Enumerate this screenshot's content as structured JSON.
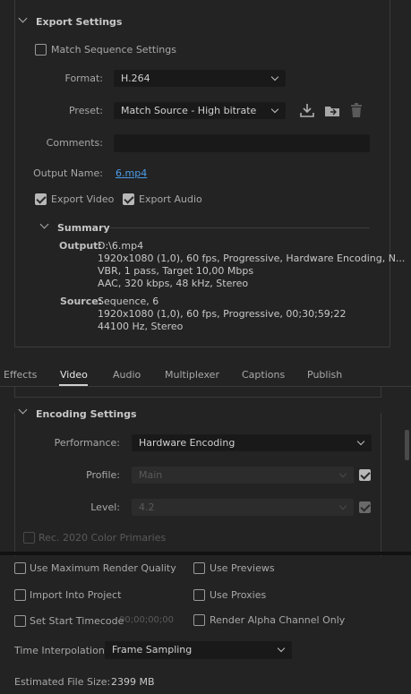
{
  "export_settings": {
    "title": "Export Settings",
    "match_sequence": "Match Sequence Settings",
    "format_label": "Format:",
    "format_value": "H.264",
    "preset_label": "Preset:",
    "preset_value": "Match Source - High bitrate",
    "comments_label": "Comments:",
    "comments_value": "",
    "output_name_label": "Output Name:",
    "output_name_value": "6.mp4",
    "export_video": "Export Video",
    "export_audio": "Export Audio"
  },
  "summary": {
    "title": "Summary",
    "output_label": "Output:",
    "output_lines": [
      "D:\\6.mp4",
      "1920x1080 (1,0), 60 fps, Progressive, Hardware Encoding, N...",
      "VBR, 1 pass, Target 10,00 Mbps",
      "AAC, 320 kbps, 48 kHz, Stereo"
    ],
    "source_label": "Source:",
    "source_lines": [
      "Sequence, 6",
      "1920x1080 (1,0), 60 fps, Progressive, 00;30;59;22",
      "44100 Hz, Stereo"
    ]
  },
  "tabs": [
    "Effects",
    "Video",
    "Audio",
    "Multiplexer",
    "Captions",
    "Publish"
  ],
  "active_tab": "Video",
  "encoding": {
    "title": "Encoding Settings",
    "performance_label": "Performance:",
    "performance_value": "Hardware Encoding",
    "profile_label": "Profile:",
    "profile_value": "Main",
    "level_label": "Level:",
    "level_value": "4.2",
    "rec2020": "Rec. 2020 Color Primaries"
  },
  "bottom": {
    "max_render_quality": "Use Maximum Render Quality",
    "use_previews": "Use Previews",
    "import_into_project": "Import Into Project",
    "use_proxies": "Use Proxies",
    "set_start_timecode": "Set Start Timecode",
    "timecode_value": "00;00;00;00",
    "render_alpha": "Render Alpha Channel Only",
    "time_interp_label": "Time Interpolation:",
    "time_interp_value": "Frame Sampling",
    "est_size_label": "Estimated File Size:",
    "est_size_value": "2399 MB"
  },
  "colors": {
    "background": "#232323",
    "field": "#191919",
    "link": "#4b9ce8"
  }
}
